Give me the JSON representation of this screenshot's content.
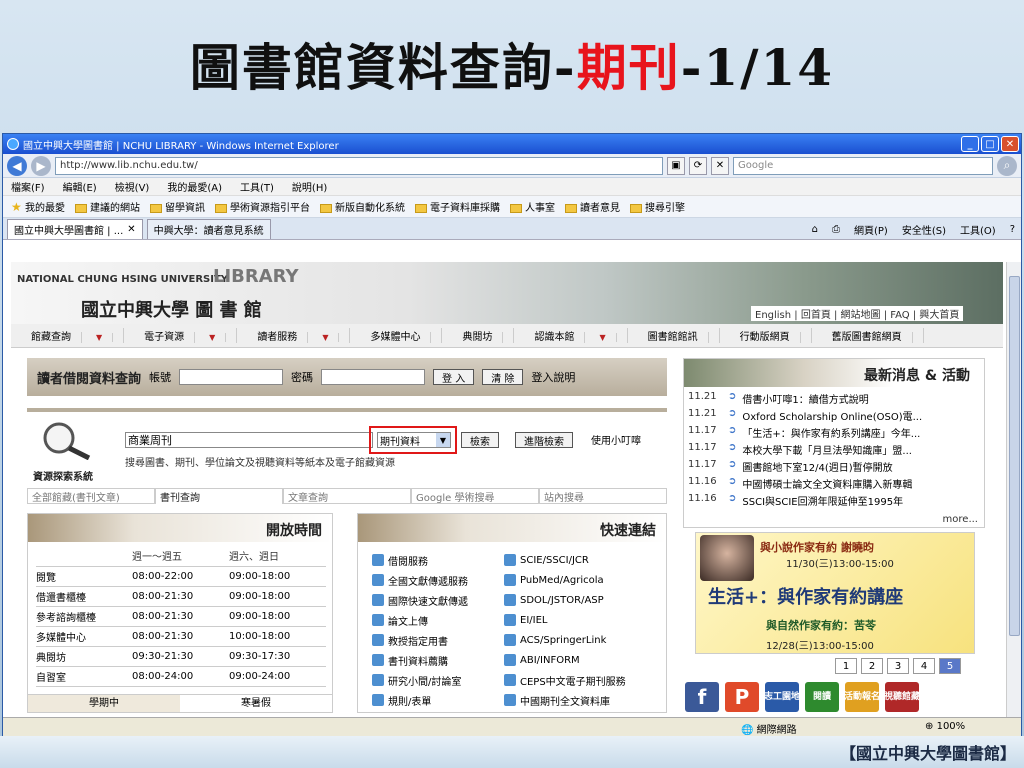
{
  "slide": {
    "title_prefix": "圖書館資料查詢-",
    "title_red": "期刊",
    "title_suffix": "-1/14",
    "footer": "【國立中興大學圖書館】"
  },
  "browser": {
    "window_title": "國立中興大學圖書館 | NCHU LIBRARY - Windows Internet Explorer",
    "address": "http://www.lib.nchu.edu.tw/",
    "search_placeholder": "Google",
    "menu": [
      "檔案(F)",
      "編輯(E)",
      "檢視(V)",
      "我的最愛(A)",
      "工具(T)",
      "說明(H)"
    ],
    "favorites_label": "我的最愛",
    "favorites": [
      "建議的網站",
      "留學資訊",
      "學術資源指引平台",
      "新版自動化系統",
      "電子資料庫採購",
      "人事室",
      "讀者意見",
      "搜尋引擎"
    ],
    "tabs": [
      "國立中興大學圖書館 | ...",
      "中興大學：讀者意見系統"
    ],
    "tools": [
      "網頁(P)",
      "安全性(S)",
      "工具(O)"
    ],
    "status_zone": "網際網路",
    "status_zoom": "100%"
  },
  "site": {
    "banner_en": "NATIONAL CHUNG HSING UNIVERSITY",
    "banner_lib": "LIBRARY",
    "banner_zh": "國立中興大學 圖 書 館",
    "top_links": "English | 回首頁 | 網站地圖 | FAQ | 興大首頁",
    "nav": [
      "館藏查詢",
      "電子資源",
      "讀者服務",
      "多媒體中心",
      "典閱坊",
      "認識本館",
      "圖書館館訊",
      "行動版網頁",
      "舊版圖書館網頁"
    ],
    "login": {
      "title": "讀者借閱資料查詢",
      "account_label": "帳號",
      "password_label": "密碼",
      "login_btn": "登 入",
      "clear_btn": "清 除",
      "help": "登入說明"
    },
    "search": {
      "system_label": "資源探索系統",
      "query": "商業周刊",
      "type": "期刊資料",
      "search_btn": "檢索",
      "advanced_btn": "進階檢索",
      "tips": "使用小叮嚀",
      "hint": "搜尋圖書、期刊、學位論文及視聽資料等紙本及電子館藏資源",
      "tabs": [
        "全部館藏(書刊文章)",
        "書刊查詢",
        "文章查詢",
        "Google 學術搜尋",
        "站內搜尋"
      ]
    },
    "hours": {
      "title": "開放時間",
      "headers": [
        "",
        "週一～週五",
        "週六、週日"
      ],
      "rows": [
        [
          "閱覽",
          "08:00-22:00",
          "09:00-18:00"
        ],
        [
          "借還書櫃檯",
          "08:00-21:30",
          "09:00-18:00"
        ],
        [
          "參考諮詢櫃檯",
          "08:00-21:30",
          "09:00-18:00"
        ],
        [
          "多媒體中心",
          "08:00-21:30",
          "10:00-18:00"
        ],
        [
          "典閱坊",
          "09:30-21:30",
          "09:30-17:30"
        ],
        [
          "自習室",
          "08:00-24:00",
          "09:00-24:00"
        ]
      ],
      "tabs": [
        "學期中",
        "寒暑假"
      ]
    },
    "quick": {
      "title": "快速連結",
      "left": [
        "借閱服務",
        "全國文獻傳遞服務",
        "國際快速文獻傳遞",
        "論文上傳",
        "教授指定用書",
        "書刊資料薦購",
        "研究小間/討論室",
        "規則/表單"
      ],
      "right": [
        "SCIE/SSCI/JCR",
        "PubMed/Agricola",
        "SDOL/JSTOR/ASP",
        "EI/IEL",
        "ACS/SpringerLink",
        "ABI/INFORM",
        "CEPS中文電子期刊服務",
        "中國期刊全文資料庫"
      ]
    },
    "news": {
      "title": "最新消息 & 活動",
      "items": [
        [
          "11.21",
          "借書小叮嚀1：續借方式說明"
        ],
        [
          "11.21",
          "Oxford Scholarship Online(OSO)電..."
        ],
        [
          "11.17",
          "「生活+：與作家有約系列講座」今年..."
        ],
        [
          "11.17",
          "本校大學下載「月旦法學知識庫」盟..."
        ],
        [
          "11.17",
          "圖書館地下室12/4(週日)暫停開放"
        ],
        [
          "11.16",
          "中國博碩士論文全文資料庫購入新專輯"
        ],
        [
          "11.16",
          "SSCI與SCIE回溯年限延伸至1995年"
        ]
      ],
      "more": "more..."
    },
    "promo": {
      "line1": "與小說作家有約 謝曉昀",
      "line2": "11/30(三)13:00-15:00",
      "line3": "生活+：與作家有約講座",
      "line4": "與自然作家有約：苦苓",
      "line5": "12/28(三)13:00-15:00"
    },
    "pager": [
      "1",
      "2",
      "3",
      "4",
      "5"
    ],
    "social": [
      "f",
      "P",
      "志工園地",
      "閱讀",
      "活動報名",
      "視聽館藏"
    ]
  }
}
